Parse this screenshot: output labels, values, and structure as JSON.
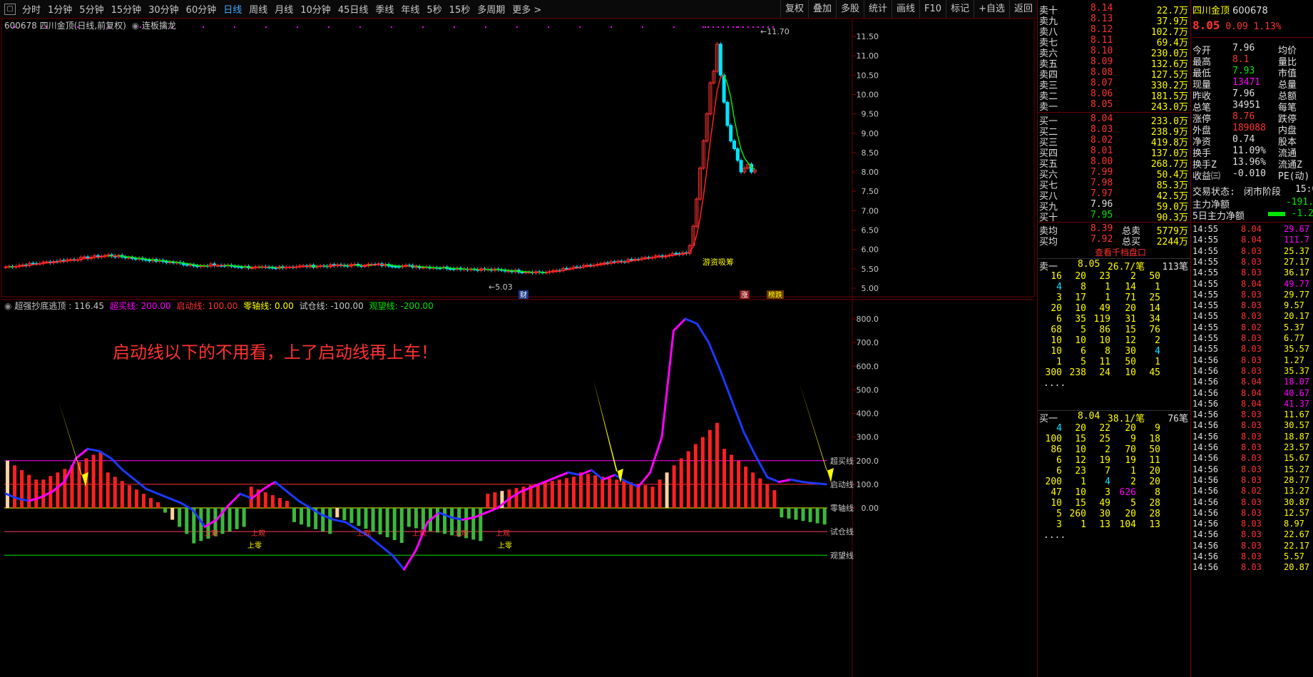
{
  "toolbar": {
    "tabs": [
      "分时",
      "1分钟",
      "5分钟",
      "15分钟",
      "30分钟",
      "60分钟",
      "日线",
      "周线",
      "月线",
      "10分钟",
      "45日线",
      "季线",
      "年线",
      "5秒",
      "15秒",
      "多周期",
      "更多 >"
    ],
    "active": "日线",
    "right": [
      "复权",
      "叠加",
      "多股",
      "统计",
      "画线",
      "F10",
      "标记",
      "+自选",
      "返回"
    ]
  },
  "main": {
    "title_code": "600678",
    "title_name": "四川金顶(日线,前复权)",
    "indicator": "连板擒龙",
    "yaxis": [
      "11.50",
      "11.00",
      "10.50",
      "10.00",
      "9.50",
      "9.00",
      "8.50",
      "8.00",
      "7.50",
      "7.00",
      "6.50",
      "6.00",
      "5.50",
      "5.00"
    ],
    "high_label": "11.70",
    "low_label": "5.03",
    "label_youzi": "游资吸筹",
    "label_cai": "财",
    "label_zhang": "涨",
    "label_bangdie": "榜跌"
  },
  "sub": {
    "title": "超强抄底逃顶 : 116.45",
    "chaomai": "超买线: 200.00",
    "qidong": "启动线: 100.00",
    "lingzhou": "零轴线: 0.00",
    "shicang": "试仓线: -100.00",
    "guanwang": "观望线: -200.00",
    "annotation": "启动线以下的不用看，上了启动线再上车！",
    "yaxis": [
      "800.0",
      "700.0",
      "600.0",
      "500.0",
      "400.0",
      "300.0",
      "200.0",
      "100.0",
      "0.00"
    ],
    "line_labels": [
      "超买线",
      "启动线",
      "零轴线",
      "试仓线",
      "观望线"
    ],
    "tag_shangguan": "上观",
    "tag_shangling": "上零"
  },
  "orderbook": {
    "sell": [
      [
        "卖十",
        "8.14",
        "22.7万"
      ],
      [
        "卖九",
        "8.13",
        "37.9万"
      ],
      [
        "卖八",
        "8.12",
        "102.7万"
      ],
      [
        "卖七",
        "8.11",
        "69.4万"
      ],
      [
        "卖六",
        "8.10",
        "230.0万"
      ],
      [
        "卖五",
        "8.09",
        "132.6万"
      ],
      [
        "卖四",
        "8.08",
        "127.5万"
      ],
      [
        "卖三",
        "8.07",
        "330.2万"
      ],
      [
        "卖二",
        "8.06",
        "181.5万"
      ],
      [
        "卖一",
        "8.05",
        "243.0万"
      ]
    ],
    "buy": [
      [
        "买一",
        "8.04",
        "233.0万"
      ],
      [
        "买二",
        "8.03",
        "238.9万"
      ],
      [
        "买三",
        "8.02",
        "419.8万"
      ],
      [
        "买四",
        "8.01",
        "137.0万"
      ],
      [
        "买五",
        "8.00",
        "268.7万"
      ],
      [
        "买六",
        "7.99",
        "50.4万"
      ],
      [
        "买七",
        "7.98",
        "85.3万"
      ],
      [
        "买八",
        "7.97",
        "42.5万"
      ],
      [
        "买九",
        "7.96",
        "59.0万"
      ],
      [
        "买十",
        "7.95",
        "90.3万"
      ]
    ],
    "sell_avg": [
      "卖均",
      "8.39",
      "总卖",
      "5779万"
    ],
    "buy_avg": [
      "买均",
      "7.92",
      "总买",
      "2244万"
    ],
    "link": "查看千档盘口",
    "sell1": [
      "卖一",
      "8.05",
      "26.7/笔",
      "113笔"
    ],
    "sell1_grid": [
      [
        "16",
        "20",
        "23",
        "2",
        "50"
      ],
      [
        "4",
        "8",
        "1",
        "14",
        "1"
      ],
      [
        "3",
        "17",
        "1",
        "71",
        "25"
      ],
      [
        "20",
        "10",
        "49",
        "20",
        "14"
      ],
      [
        "6",
        "35",
        "119",
        "31",
        "34"
      ],
      [
        "68",
        "5",
        "86",
        "15",
        "76"
      ],
      [
        "10",
        "10",
        "10",
        "12",
        "2"
      ],
      [
        "10",
        "6",
        "8",
        "30",
        "4"
      ],
      [
        "1",
        "5",
        "11",
        "50",
        "1"
      ],
      [
        "300",
        "238",
        "24",
        "10",
        "45"
      ]
    ],
    "buy1": [
      "买一",
      "8.04",
      "38.1/笔",
      "76笔"
    ],
    "buy1_grid": [
      [
        "4",
        "20",
        "22",
        "20",
        "9"
      ],
      [
        "100",
        "15",
        "25",
        "9",
        "18"
      ],
      [
        "86",
        "10",
        "2",
        "70",
        "50"
      ],
      [
        "6",
        "12",
        "19",
        "19",
        "11"
      ],
      [
        "6",
        "23",
        "7",
        "1",
        "20"
      ],
      [
        "200",
        "1",
        "4",
        "2",
        "20"
      ],
      [
        "47",
        "10",
        "3",
        "626",
        "8"
      ],
      [
        "10",
        "15",
        "49",
        "5",
        "28"
      ],
      [
        "5",
        "260",
        "30",
        "20",
        "28"
      ],
      [
        "3",
        "1",
        "13",
        "104",
        "13"
      ]
    ],
    "dots": "...."
  },
  "quote": {
    "name": "四川金顶",
    "code": "600678",
    "price": "8.05",
    "change": "0.09",
    "pct": "1.13%",
    "rows": [
      [
        "今开",
        "7.96",
        "均价"
      ],
      [
        "最高",
        "8.1",
        "量比"
      ],
      [
        "最低",
        "7.93",
        "市值"
      ],
      [
        "现量",
        "13471",
        "总量"
      ],
      [
        "昨收",
        "7.96",
        "总额"
      ],
      [
        "总笔",
        "34951",
        "每笔"
      ],
      [
        "涨停",
        "8.76",
        "跌停"
      ],
      [
        "外盘",
        "189088",
        "内盘"
      ],
      [
        "净资",
        "0.74",
        "股本"
      ],
      [
        "换手",
        "11.09%",
        "流通"
      ],
      [
        "换手Z",
        "13.96%",
        "流通Z"
      ],
      [
        "收益㈢",
        "-0.010",
        "PE(动)"
      ]
    ],
    "status_label": "交易状态:",
    "status": "闭市阶段",
    "status_time": "15:0",
    "flow1_label": "主力净额",
    "flow1": "-191.",
    "flow2_label": "5日主力净额",
    "flow2": "-1.2"
  },
  "ticks": [
    [
      "14:55",
      "8.04",
      "29.67"
    ],
    [
      "14:55",
      "8.04",
      "111.7"
    ],
    [
      "14:55",
      "8.03",
      "25.37"
    ],
    [
      "14:55",
      "8.03",
      "27.17"
    ],
    [
      "14:55",
      "8.03",
      "36.17"
    ],
    [
      "14:55",
      "8.04",
      "49.77"
    ],
    [
      "14:55",
      "8.03",
      "29.77"
    ],
    [
      "14:55",
      "8.03",
      "9.57"
    ],
    [
      "14:55",
      "8.03",
      "20.17"
    ],
    [
      "14:55",
      "8.02",
      "5.37"
    ],
    [
      "14:55",
      "8.03",
      "6.77"
    ],
    [
      "14:55",
      "8.03",
      "35.57"
    ],
    [
      "14:56",
      "8.03",
      "1.27"
    ],
    [
      "14:56",
      "8.03",
      "35.37"
    ],
    [
      "14:56",
      "8.04",
      "18.07"
    ],
    [
      "14:56",
      "8.04",
      "40.67"
    ],
    [
      "14:56",
      "8.04",
      "41.37"
    ],
    [
      "14:56",
      "8.03",
      "11.67"
    ],
    [
      "14:56",
      "8.03",
      "30.57"
    ],
    [
      "14:56",
      "8.03",
      "18.87"
    ],
    [
      "14:56",
      "8.03",
      "23.57"
    ],
    [
      "14:56",
      "8.03",
      "15.67"
    ],
    [
      "14:56",
      "8.03",
      "15.27"
    ],
    [
      "14:56",
      "8.03",
      "28.77"
    ],
    [
      "14:56",
      "8.02",
      "13.27"
    ],
    [
      "14:56",
      "8.03",
      "30.87"
    ],
    [
      "14:56",
      "8.03",
      "12.57"
    ],
    [
      "14:56",
      "8.03",
      "8.97"
    ],
    [
      "14:56",
      "8.03",
      "22.67"
    ],
    [
      "14:56",
      "8.03",
      "22.17"
    ],
    [
      "14:56",
      "8.03",
      "5.57"
    ],
    [
      "14:56",
      "8.03",
      "20.87"
    ]
  ]
}
